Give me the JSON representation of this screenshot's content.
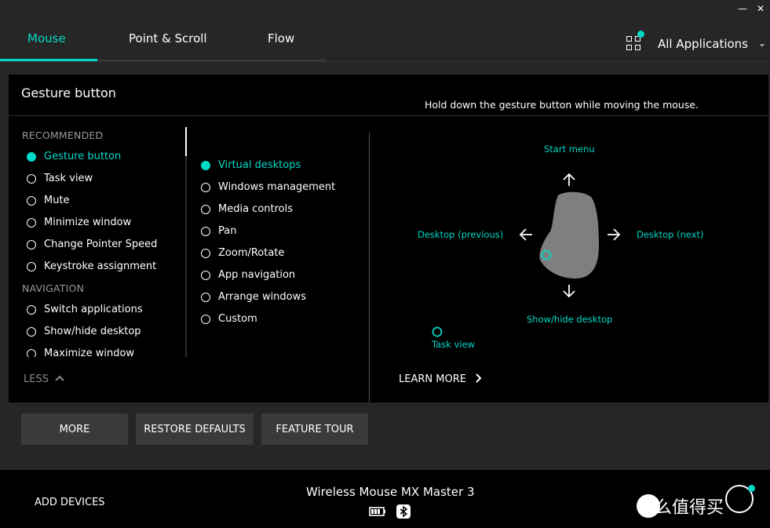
{
  "window": {
    "minimize_glyph": "—",
    "close_glyph": "✕"
  },
  "tabs": [
    {
      "label": "Mouse",
      "active": true
    },
    {
      "label": "Point & Scroll",
      "active": false
    },
    {
      "label": "Flow",
      "active": false
    }
  ],
  "app_selector": {
    "label": "All Applications",
    "icon": "grid-icon",
    "chevron": "⌄"
  },
  "panel": {
    "title": "Gesture button",
    "hint": "Hold down the gesture button while moving the mouse.",
    "recommended_header": "RECOMMENDED",
    "recommended": [
      {
        "label": "Gesture button",
        "selected": true
      },
      {
        "label": "Task view",
        "selected": false
      },
      {
        "label": "Mute",
        "selected": false
      },
      {
        "label": "Minimize window",
        "selected": false
      },
      {
        "label": "Change Pointer Speed",
        "selected": false
      },
      {
        "label": "Keystroke assignment",
        "selected": false
      }
    ],
    "navigation_header": "NAVIGATION",
    "navigation": [
      {
        "label": "Switch applications",
        "selected": false
      },
      {
        "label": "Show/hide desktop",
        "selected": false
      },
      {
        "label": "Maximize window",
        "selected": false
      }
    ],
    "less_label": "LESS",
    "gesture_options": [
      {
        "label": "Virtual desktops",
        "selected": true
      },
      {
        "label": "Windows management",
        "selected": false
      },
      {
        "label": "Media controls",
        "selected": false
      },
      {
        "label": "Pan",
        "selected": false
      },
      {
        "label": "Zoom/Rotate",
        "selected": false
      },
      {
        "label": "App navigation",
        "selected": false
      },
      {
        "label": "Arrange windows",
        "selected": false
      },
      {
        "label": "Custom",
        "selected": false
      }
    ],
    "diagram": {
      "up": "Start menu",
      "left": "Desktop (previous)",
      "right": "Desktop (next)",
      "down": "Show/hide desktop",
      "click": "Task view"
    },
    "learn_more": "LEARN MORE"
  },
  "buttons": {
    "more": "MORE",
    "restore": "RESTORE DEFAULTS",
    "tour": "FEATURE TOUR"
  },
  "footer": {
    "add_devices": "ADD DEVICES",
    "device_name": "Wireless Mouse MX Master 3",
    "watermark": "什么值得买",
    "watermark_logo": "值"
  },
  "colors": {
    "accent": "#00d9c7",
    "background": "#262626",
    "panel": "#000000"
  }
}
